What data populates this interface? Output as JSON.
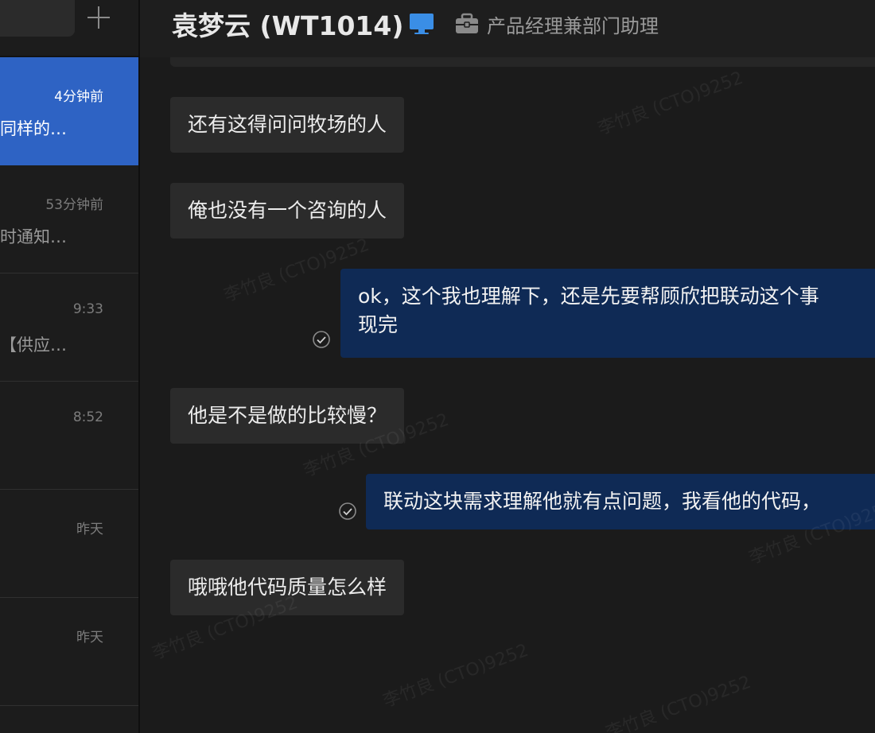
{
  "sidebar": {
    "add_button_icon": "plus-icon",
    "conversations": [
      {
        "time": "4分钟前",
        "preview": "也会同样的…",
        "active": true
      },
      {
        "time": "53分钟前",
        "preview": "个定时通知…",
        "active": false
      },
      {
        "time": "9:33",
        "preview": "等到【供应…",
        "active": false
      },
      {
        "time": "8:52",
        "preview": "",
        "active": false
      },
      {
        "time": "昨天",
        "preview": "",
        "active": false
      },
      {
        "time": "昨天",
        "preview": "",
        "active": false
      }
    ]
  },
  "header": {
    "title": "袁梦云 (WT1014)",
    "status_icon": "desktop-icon",
    "role_icon": "briefcase-icon",
    "role": "产品经理兼部门助理"
  },
  "messages": [
    {
      "direction": "in",
      "text": "还有这得问问牧场的人"
    },
    {
      "direction": "in",
      "text": "俺也没有一个咨询的人"
    },
    {
      "direction": "out",
      "line1": "ok，这个我也理解下，还是先要帮顾欣把联动这个事",
      "line2": "现完",
      "read": true
    },
    {
      "direction": "in",
      "text": "他是不是做的比较慢？"
    },
    {
      "direction": "out",
      "text": "联动这块需求理解他就有点问题，我看他的代码，",
      "read": true
    },
    {
      "direction": "in",
      "text": "哦哦他代码质量怎么样"
    }
  ],
  "watermark": "李竹良 (CTO)9252",
  "colors": {
    "accent": "#2e63c4",
    "outgoing_bubble": "#0f2a55",
    "incoming_bubble": "#2b2b2b"
  }
}
